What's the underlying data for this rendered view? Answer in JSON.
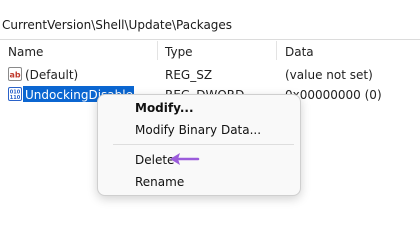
{
  "address": {
    "path": "CurrentVersion\\Shell\\Update\\Packages"
  },
  "columns": [
    "Name",
    "Type",
    "Data"
  ],
  "rows": [
    {
      "name": "(Default)",
      "type": "REG_SZ",
      "data": "(value not set)",
      "icon": "string-value-icon"
    },
    {
      "name": "UndockingDisabled",
      "type": "REG_DWORD",
      "data": "0x00000000 (0)",
      "icon": "binary-value-icon",
      "selected": true
    }
  ],
  "context_menu": {
    "items": [
      "Modify...",
      "Modify Binary Data...",
      "Delete",
      "Rename"
    ]
  },
  "colors": {
    "selection": "#0b66d1",
    "arrow": "#9b5cdb",
    "dword_icon": "#2a62c9",
    "string_icon": "#c0392b"
  }
}
